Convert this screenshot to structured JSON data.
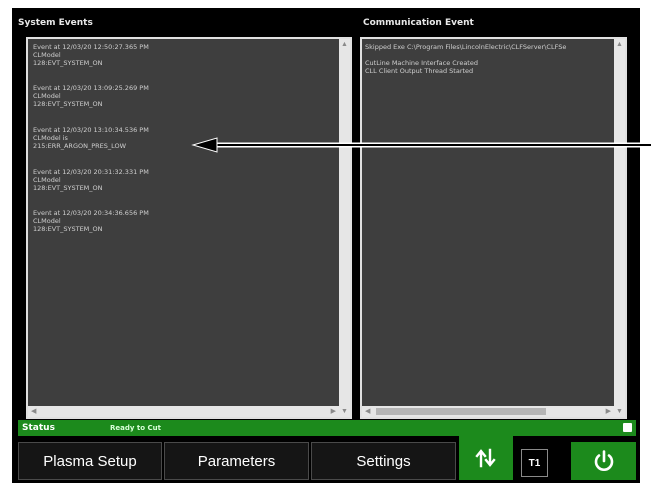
{
  "system_events": {
    "title": "System Events",
    "events": [
      {
        "line1": "Event at 12/03/20 12:50:27.365 PM",
        "line2": "CLModel",
        "line3": "128:EVT_SYSTEM_ON"
      },
      {
        "line1": "Event at 12/03/20 13:09:25.269 PM",
        "line2": "CLModel",
        "line3": "128:EVT_SYSTEM_ON"
      },
      {
        "line1": "Event at 12/03/20 13:10:34.536 PM",
        "line2": "CLModel is",
        "line3": "215:ERR_ARGON_PRES_LOW"
      },
      {
        "line1": "Event at 12/03/20 20:31:32.331 PM",
        "line2": "CLModel",
        "line3": "128:EVT_SYSTEM_ON"
      },
      {
        "line1": "Event at 12/03/20 20:34:36.656 PM",
        "line2": "CLModel",
        "line3": "128:EVT_SYSTEM_ON"
      }
    ]
  },
  "communication_event": {
    "title": "Communication Event",
    "lines": [
      "Skipped Exe C:\\Program Files\\LincolnElectric\\CLFServer\\CLFSe",
      "CutLine Machine Interface Created",
      "CLL Client Output Thread Started"
    ]
  },
  "status": {
    "label": "Status",
    "value": "Ready to Cut"
  },
  "buttons": {
    "plasma_setup": "Plasma Setup",
    "parameters": "Parameters",
    "settings": "Settings",
    "t1": "T1"
  },
  "icons": {
    "swap": "swap-arrows-icon",
    "power": "power-icon"
  },
  "colors": {
    "accent_green": "#1c8a1c",
    "background": "#000000",
    "panel": "#3e3e3e"
  }
}
